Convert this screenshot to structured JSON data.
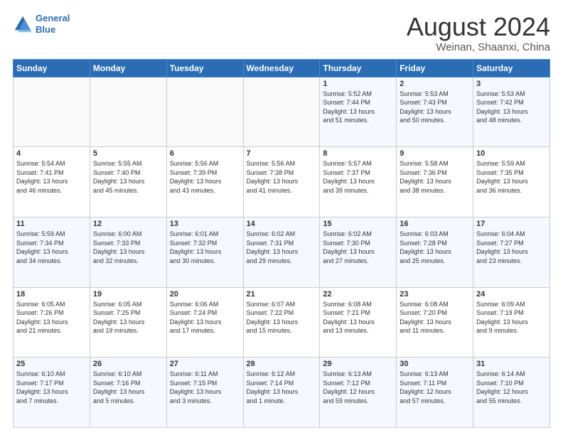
{
  "header": {
    "logo_line1": "General",
    "logo_line2": "Blue",
    "main_title": "August 2024",
    "subtitle": "Weinan, Shaanxi, China"
  },
  "weekdays": [
    "Sunday",
    "Monday",
    "Tuesday",
    "Wednesday",
    "Thursday",
    "Friday",
    "Saturday"
  ],
  "weeks": [
    [
      {
        "day": "",
        "info": ""
      },
      {
        "day": "",
        "info": ""
      },
      {
        "day": "",
        "info": ""
      },
      {
        "day": "",
        "info": ""
      },
      {
        "day": "1",
        "info": "Sunrise: 5:52 AM\nSunset: 7:44 PM\nDaylight: 13 hours\nand 51 minutes."
      },
      {
        "day": "2",
        "info": "Sunrise: 5:53 AM\nSunset: 7:43 PM\nDaylight: 13 hours\nand 50 minutes."
      },
      {
        "day": "3",
        "info": "Sunrise: 5:53 AM\nSunset: 7:42 PM\nDaylight: 13 hours\nand 48 minutes."
      }
    ],
    [
      {
        "day": "4",
        "info": "Sunrise: 5:54 AM\nSunset: 7:41 PM\nDaylight: 13 hours\nand 46 minutes."
      },
      {
        "day": "5",
        "info": "Sunrise: 5:55 AM\nSunset: 7:40 PM\nDaylight: 13 hours\nand 45 minutes."
      },
      {
        "day": "6",
        "info": "Sunrise: 5:56 AM\nSunset: 7:39 PM\nDaylight: 13 hours\nand 43 minutes."
      },
      {
        "day": "7",
        "info": "Sunrise: 5:56 AM\nSunset: 7:38 PM\nDaylight: 13 hours\nand 41 minutes."
      },
      {
        "day": "8",
        "info": "Sunrise: 5:57 AM\nSunset: 7:37 PM\nDaylight: 13 hours\nand 39 minutes."
      },
      {
        "day": "9",
        "info": "Sunrise: 5:58 AM\nSunset: 7:36 PM\nDaylight: 13 hours\nand 38 minutes."
      },
      {
        "day": "10",
        "info": "Sunrise: 5:59 AM\nSunset: 7:35 PM\nDaylight: 13 hours\nand 36 minutes."
      }
    ],
    [
      {
        "day": "11",
        "info": "Sunrise: 5:59 AM\nSunset: 7:34 PM\nDaylight: 13 hours\nand 34 minutes."
      },
      {
        "day": "12",
        "info": "Sunrise: 6:00 AM\nSunset: 7:33 PM\nDaylight: 13 hours\nand 32 minutes."
      },
      {
        "day": "13",
        "info": "Sunrise: 6:01 AM\nSunset: 7:32 PM\nDaylight: 13 hours\nand 30 minutes."
      },
      {
        "day": "14",
        "info": "Sunrise: 6:02 AM\nSunset: 7:31 PM\nDaylight: 13 hours\nand 29 minutes."
      },
      {
        "day": "15",
        "info": "Sunrise: 6:02 AM\nSunset: 7:30 PM\nDaylight: 13 hours\nand 27 minutes."
      },
      {
        "day": "16",
        "info": "Sunrise: 6:03 AM\nSunset: 7:28 PM\nDaylight: 13 hours\nand 25 minutes."
      },
      {
        "day": "17",
        "info": "Sunrise: 6:04 AM\nSunset: 7:27 PM\nDaylight: 13 hours\nand 23 minutes."
      }
    ],
    [
      {
        "day": "18",
        "info": "Sunrise: 6:05 AM\nSunset: 7:26 PM\nDaylight: 13 hours\nand 21 minutes."
      },
      {
        "day": "19",
        "info": "Sunrise: 6:05 AM\nSunset: 7:25 PM\nDaylight: 13 hours\nand 19 minutes."
      },
      {
        "day": "20",
        "info": "Sunrise: 6:06 AM\nSunset: 7:24 PM\nDaylight: 13 hours\nand 17 minutes."
      },
      {
        "day": "21",
        "info": "Sunrise: 6:07 AM\nSunset: 7:22 PM\nDaylight: 13 hours\nand 15 minutes."
      },
      {
        "day": "22",
        "info": "Sunrise: 6:08 AM\nSunset: 7:21 PM\nDaylight: 13 hours\nand 13 minutes."
      },
      {
        "day": "23",
        "info": "Sunrise: 6:08 AM\nSunset: 7:20 PM\nDaylight: 13 hours\nand 11 minutes."
      },
      {
        "day": "24",
        "info": "Sunrise: 6:09 AM\nSunset: 7:19 PM\nDaylight: 13 hours\nand 9 minutes."
      }
    ],
    [
      {
        "day": "25",
        "info": "Sunrise: 6:10 AM\nSunset: 7:17 PM\nDaylight: 13 hours\nand 7 minutes."
      },
      {
        "day": "26",
        "info": "Sunrise: 6:10 AM\nSunset: 7:16 PM\nDaylight: 13 hours\nand 5 minutes."
      },
      {
        "day": "27",
        "info": "Sunrise: 6:11 AM\nSunset: 7:15 PM\nDaylight: 13 hours\nand 3 minutes."
      },
      {
        "day": "28",
        "info": "Sunrise: 6:12 AM\nSunset: 7:14 PM\nDaylight: 13 hours\nand 1 minute."
      },
      {
        "day": "29",
        "info": "Sunrise: 6:13 AM\nSunset: 7:12 PM\nDaylight: 12 hours\nand 59 minutes."
      },
      {
        "day": "30",
        "info": "Sunrise: 6:13 AM\nSunset: 7:11 PM\nDaylight: 12 hours\nand 57 minutes."
      },
      {
        "day": "31",
        "info": "Sunrise: 6:14 AM\nSunset: 7:10 PM\nDaylight: 12 hours\nand 55 minutes."
      }
    ]
  ]
}
